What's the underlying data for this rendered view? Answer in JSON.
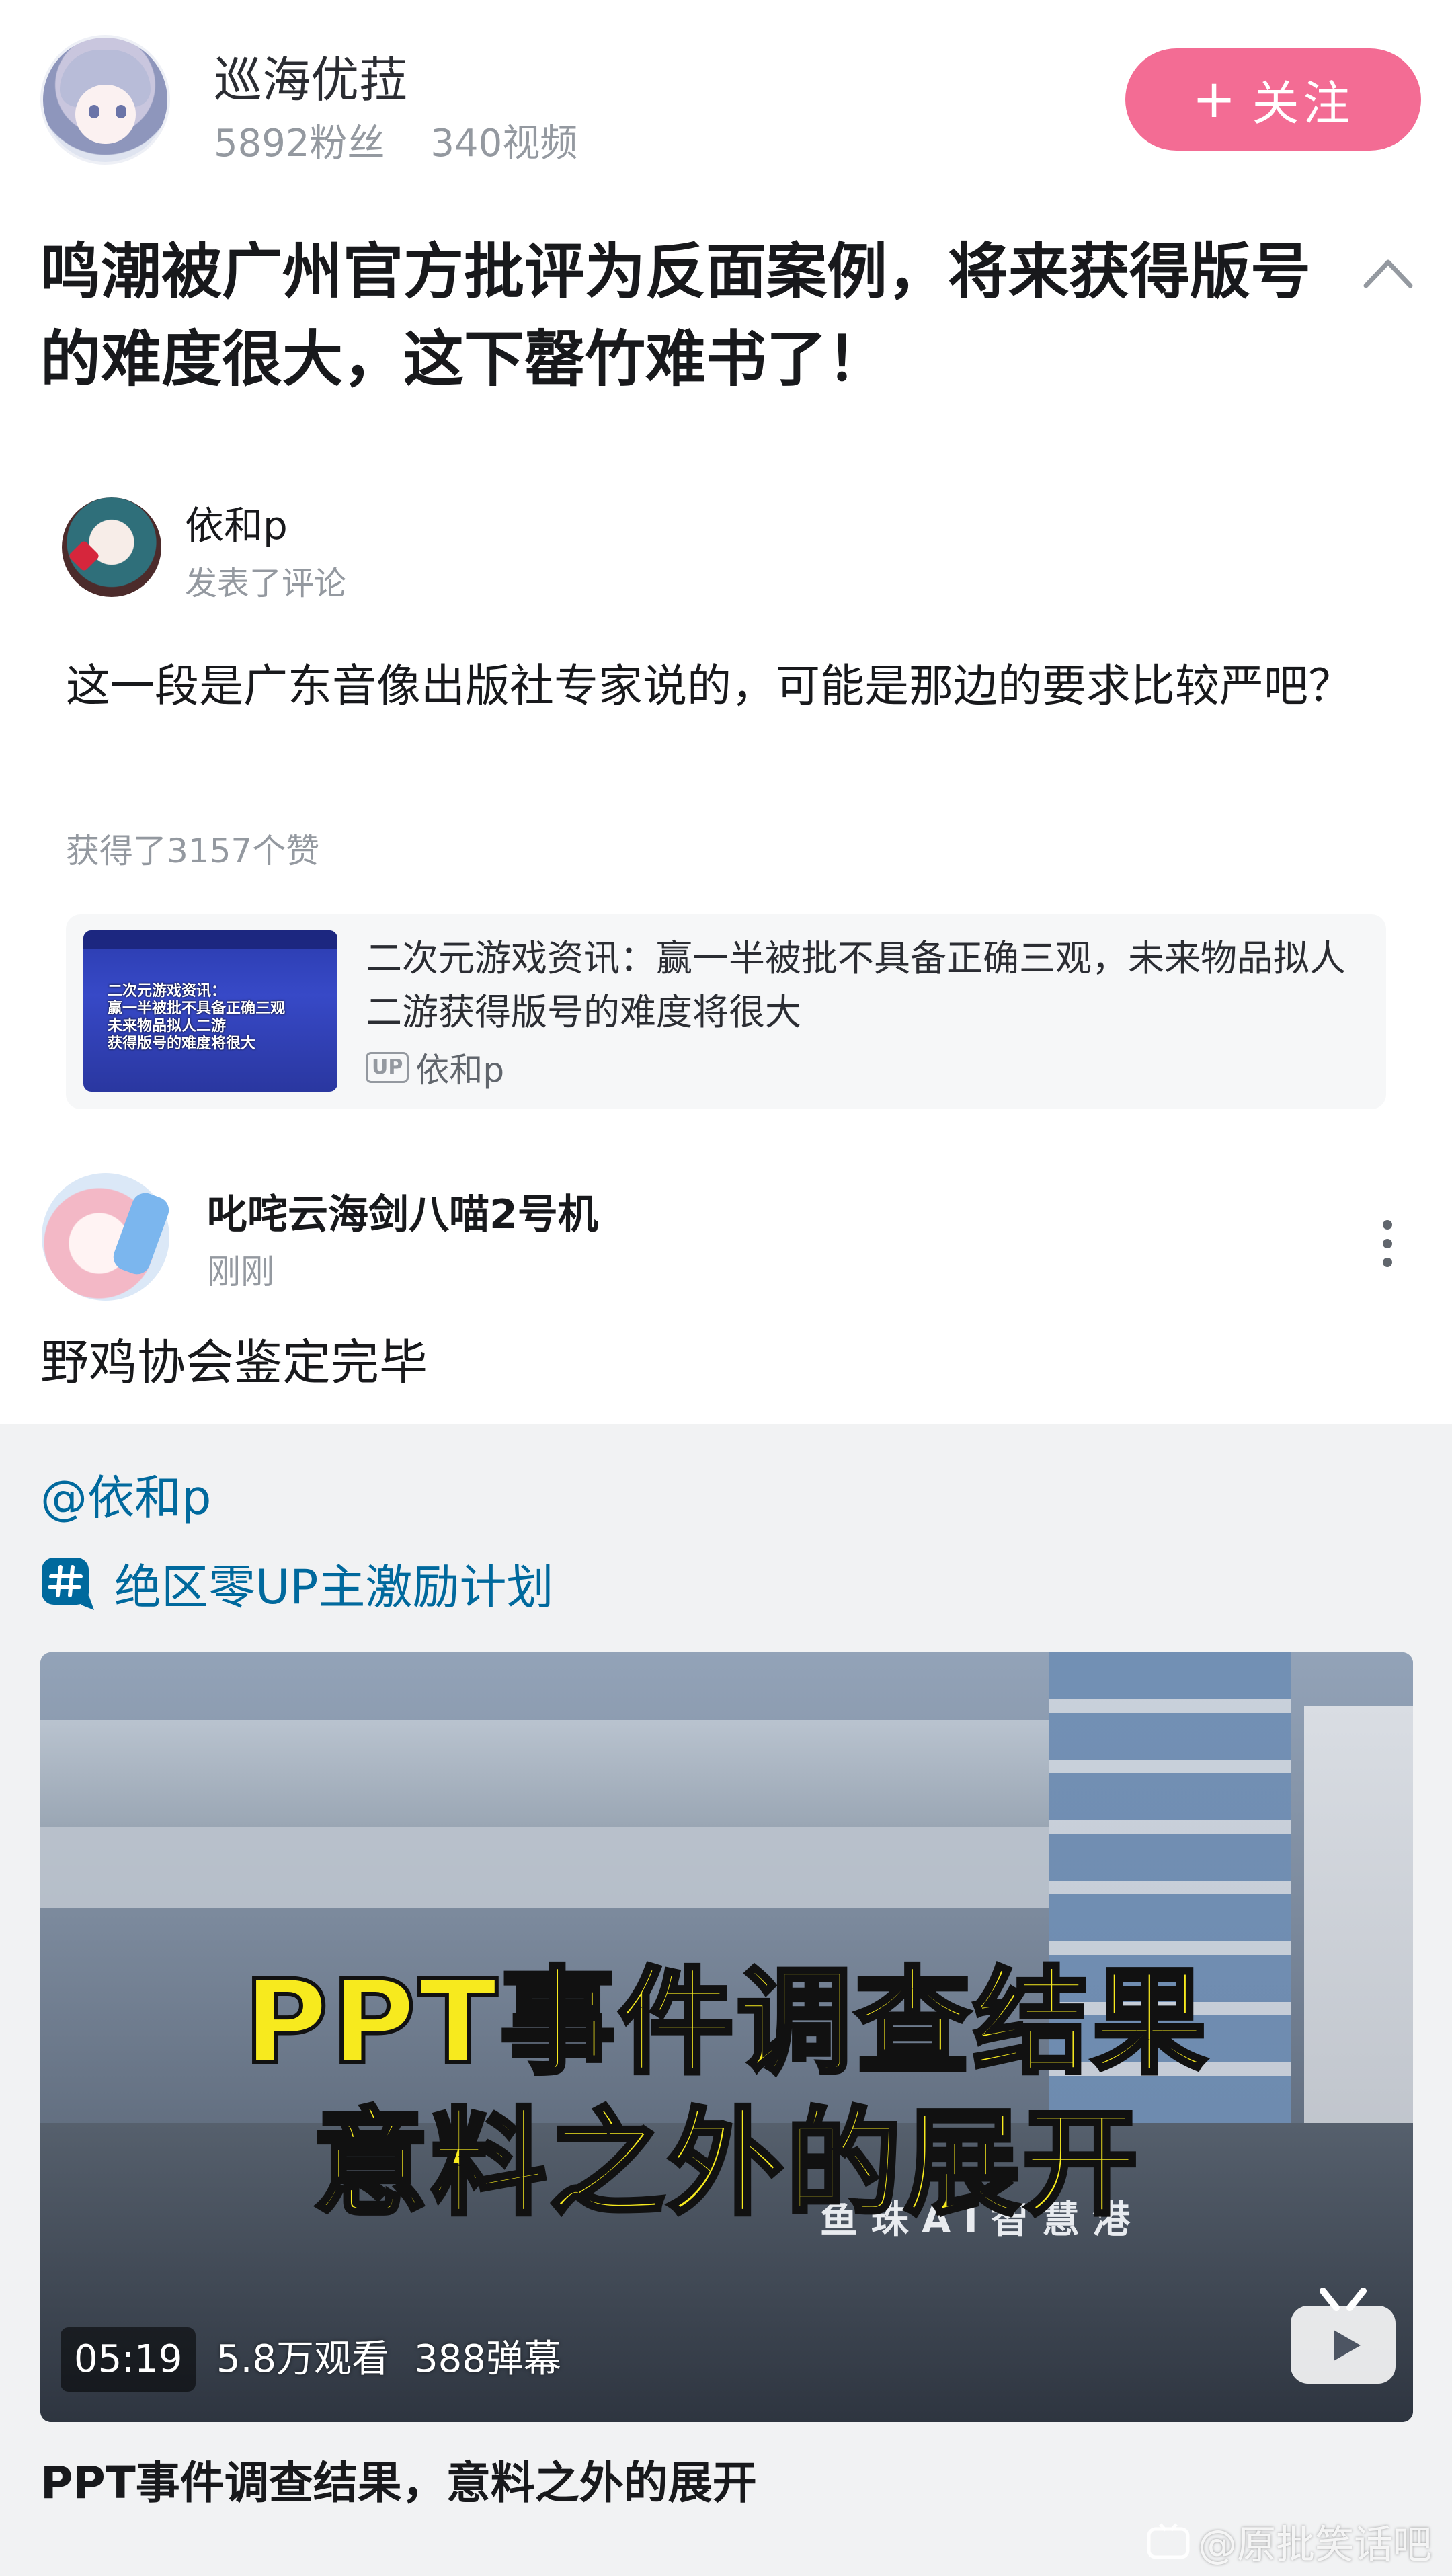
{
  "header": {
    "username": "巡海优菈",
    "fans": "5892粉丝",
    "videos": "340视频",
    "follow_label": "关注",
    "follow_plus": "+"
  },
  "post": {
    "title": "鸣潮被广州官方批评为反面案例，将来获得版号的难度很大，这下罄竹难书了！"
  },
  "comment": {
    "author": "依和p",
    "action": "发表了评论",
    "text": "这一段是广东音像出版社专家说的，可能是那边的要求比较严吧？",
    "likes": "获得了3157个赞",
    "card": {
      "title": "二次元游戏资讯：赢一半被批不具备正确三观，未来物品拟人二游获得版号的难度将很大",
      "up_badge": "UP",
      "up_name": "依和p",
      "thumb_lines": [
        "二次元游戏资讯：",
        "赢一半被批不具备正确三观",
        "未来物品拟人二游",
        "获得版号的难度将很大"
      ]
    }
  },
  "reply": {
    "author": "叱咤云海剑八喵2号机",
    "time": "刚刚",
    "text": "野鸡协会鉴定完毕"
  },
  "forward": {
    "mention": "@依和p",
    "topic": "绝区零UP主激励计划",
    "video": {
      "overlay_line1": "PPT事件调查结果",
      "overlay_line2": "意料之外的展开",
      "sign_text": "鱼 珠 A I 智 慧 港",
      "duration": "05:19",
      "views": "5.8万观看",
      "danmaku": "388弹幕",
      "title": "PPT事件调查结果，意料之外的展开"
    }
  },
  "watermark": "@原批笑话吧",
  "colors": {
    "follow_bg": "#f36c94",
    "link": "#00699d",
    "muted": "#9499a0",
    "overlay_yellow": "#f7ea1e"
  }
}
